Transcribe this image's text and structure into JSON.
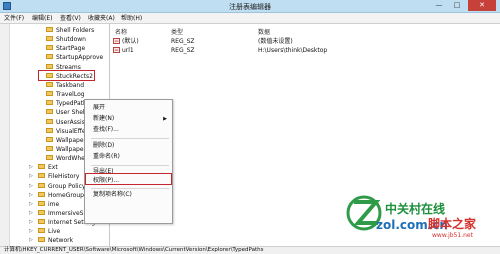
{
  "window": {
    "title": "注册表编辑器",
    "min": "—",
    "max": "□",
    "close": "✕"
  },
  "menu": [
    "文件(F)",
    "编辑(E)",
    "查看(V)",
    "收藏夹(A)",
    "帮助(H)"
  ],
  "tree": [
    {
      "label": "Shell Folders",
      "level": 1
    },
    {
      "label": "Shutdown",
      "level": 1
    },
    {
      "label": "StartPage",
      "level": 1
    },
    {
      "label": "StartupApprove",
      "level": 1
    },
    {
      "label": "Streams",
      "level": 1
    },
    {
      "label": "StuckRects2",
      "level": 1
    },
    {
      "label": "Taskband",
      "level": 1
    },
    {
      "label": "TravelLog",
      "level": 1
    },
    {
      "label": "TypedPaths",
      "level": 1,
      "selected": true
    },
    {
      "label": "User Shell F",
      "level": 1
    },
    {
      "label": "UserAssist",
      "level": 1
    },
    {
      "label": "VisualEffect",
      "level": 1
    },
    {
      "label": "Wallpaper",
      "level": 1
    },
    {
      "label": "Wallpapers",
      "level": 1
    },
    {
      "label": "WordWheel",
      "level": 1
    },
    {
      "label": "Ext",
      "level": 0
    },
    {
      "label": "FileHistory",
      "level": 0
    },
    {
      "label": "Group Policy",
      "level": 0
    },
    {
      "label": "HomeGroup",
      "level": 0
    },
    {
      "label": "ime",
      "level": 0
    },
    {
      "label": "ImmersiveShell",
      "level": 0
    },
    {
      "label": "Internet Settings",
      "level": 0
    },
    {
      "label": "Live",
      "level": 0
    },
    {
      "label": "Network",
      "level": 0
    }
  ],
  "list": {
    "headers": [
      "名称",
      "类型",
      "数据"
    ],
    "rows": [
      {
        "icon": "ab",
        "name": "(默认)",
        "type": "REG_SZ",
        "data": "(数值未设置)"
      },
      {
        "icon": "ab",
        "name": "url1",
        "type": "REG_SZ",
        "data": "H:\\Users\\think\\Desktop"
      }
    ]
  },
  "context_menu": {
    "items": [
      {
        "label": "展开"
      },
      {
        "label": "新建(N)",
        "submenu": true
      },
      {
        "label": "查找(F)..."
      },
      {
        "sep": true
      },
      {
        "label": "删除(D)"
      },
      {
        "label": "重命名(R)"
      },
      {
        "sep": true
      },
      {
        "label": "导出(E)"
      },
      {
        "label": "权限(P)...",
        "highlighted": true
      },
      {
        "sep": true
      },
      {
        "label": "复制项名称(C)"
      }
    ]
  },
  "statusbar": "计算机\\HKEY_CURRENT_USER\\Software\\Microsoft\\Windows\\CurrentVersion\\Explorer\\TypedPaths",
  "watermark": {
    "line1": "中关村在线",
    "line2": "zol.com.cn",
    "line3": "脚本之家",
    "line4": "www.jb51.net"
  },
  "colors": {
    "highlight_box": "#c4262d",
    "folder": "#f2c75c"
  }
}
